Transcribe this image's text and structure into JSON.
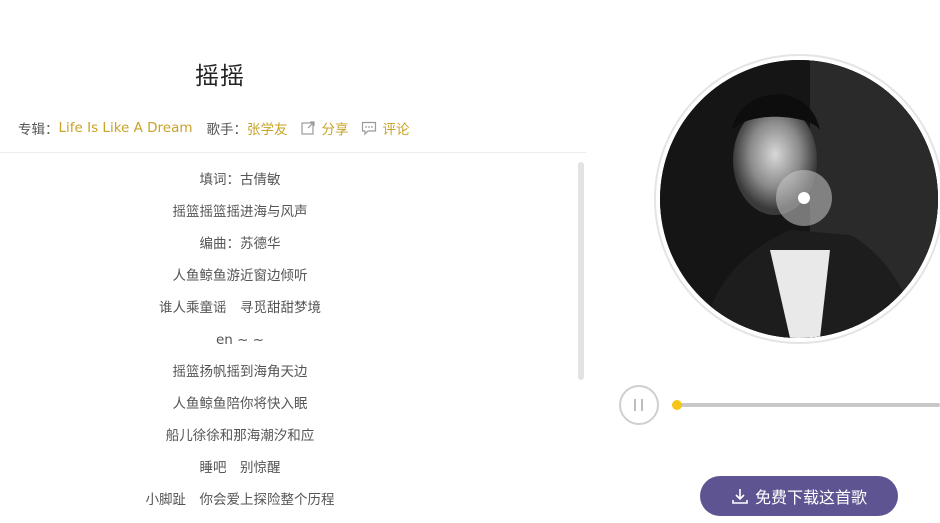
{
  "song": {
    "title": "摇摇"
  },
  "meta": {
    "album_label": "专辑：",
    "album_name": "Life Is Like A Dream",
    "singer_label": "歌手：",
    "singer_name": "张学友",
    "share_label": "分享",
    "comment_label": "评论"
  },
  "lyrics": [
    "填词：古倩敏",
    "摇篮摇篮摇进海与风声",
    "编曲：苏德华",
    "人鱼鲸鱼游近窗边倾听",
    "谁人乘童谣　寻觅甜甜梦境",
    "en ~ ~",
    "摇篮扬帆摇到海角天边",
    "人鱼鲸鱼陪你将快入眠",
    "船儿徐徐和那海潮汐和应",
    "睡吧　别惊醒",
    "小脚趾　你会爱上探险整个历程"
  ],
  "player": {
    "state": "playing",
    "progress": 0.02
  },
  "download": {
    "label": "免费下载这首歌"
  },
  "colors": {
    "accent_gold": "#c9a227",
    "progress_yellow": "#f2c326",
    "download_purple": "#5e5491"
  },
  "icons": {
    "share": "external-link-icon",
    "comment": "comment-bubble-icon",
    "pause": "pause-icon",
    "download": "download-icon"
  }
}
